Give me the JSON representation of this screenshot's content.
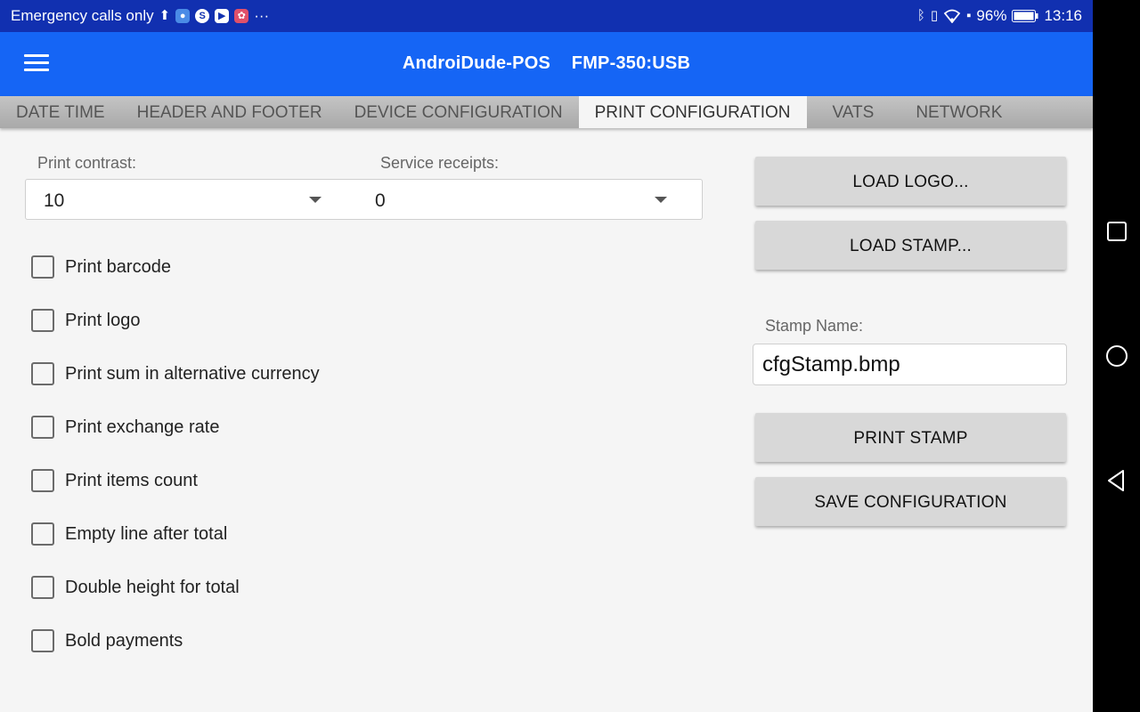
{
  "status_bar": {
    "carrier": "Emergency calls only",
    "ellipsis": "···",
    "battery": "96%",
    "time": "13:16"
  },
  "app_bar": {
    "title": "AndroiDude-POS",
    "device": "FMP-350:USB"
  },
  "tabs": [
    {
      "label": "DATE TIME"
    },
    {
      "label": "HEADER AND FOOTER"
    },
    {
      "label": "DEVICE CONFIGURATION"
    },
    {
      "label": "PRINT CONFIGURATION",
      "active": true
    },
    {
      "label": "VATS"
    },
    {
      "label": "NETWORK"
    }
  ],
  "print_contrast": {
    "label": "Print contrast:",
    "value": "10"
  },
  "service_receipts": {
    "label": "Service receipts:",
    "value": "0"
  },
  "checkboxes": [
    {
      "label": "Print barcode",
      "checked": false
    },
    {
      "label": "Print logo",
      "checked": false
    },
    {
      "label": "Print sum in alternative currency",
      "checked": false
    },
    {
      "label": "Print exchange rate",
      "checked": false
    },
    {
      "label": "Print items count",
      "checked": false
    },
    {
      "label": "Empty line after total",
      "checked": false
    },
    {
      "label": "Double height for total",
      "checked": false
    },
    {
      "label": "Bold payments",
      "checked": false
    }
  ],
  "buttons": {
    "load_logo": "LOAD LOGO...",
    "load_stamp": "LOAD STAMP...",
    "print_stamp": "PRINT STAMP",
    "save_configuration": "SAVE CONFIGURATION"
  },
  "stamp_name": {
    "label": "Stamp Name:",
    "value": "cfgStamp.bmp"
  },
  "colors": {
    "status_bar": "#1130b0",
    "app_bar": "#1565f5",
    "button": "#d8d8d8",
    "background": "#f5f5f5"
  }
}
